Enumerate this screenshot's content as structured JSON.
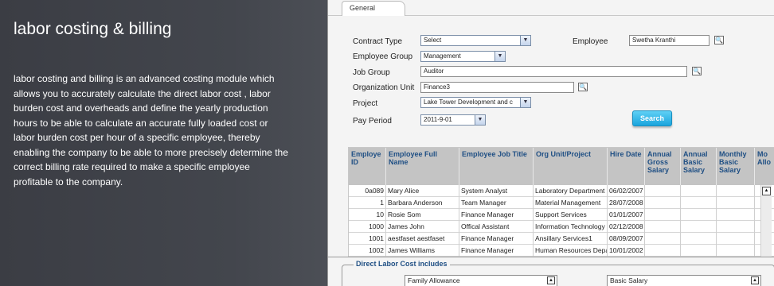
{
  "promo": {
    "title": "labor costing & billing",
    "description": "labor costing and billing is an advanced costing module which allows you to accurately calculate the direct labor cost , labor burden cost and overheads and define the yearly production hours to be able to calculate an accurate fully loaded cost or labor burden cost per hour of a specific employee, thereby enabling the company to be able to more precisely determine the correct billing rate required to make a specific employee profitable to the company."
  },
  "tabs": {
    "general": "General"
  },
  "form": {
    "contract_type": {
      "label": "Contract Type",
      "value": "Select"
    },
    "employee": {
      "label": "Employee",
      "value": "Swetha Kranthi"
    },
    "employee_group": {
      "label": "Employee Group",
      "value": "Management"
    },
    "job_group": {
      "label": "Job Group",
      "value": "Auditor"
    },
    "org_unit": {
      "label": "Organization Unit",
      "value": "Finance3"
    },
    "project": {
      "label": "Project",
      "value": "Lake Tower Development and  c"
    },
    "pay_period": {
      "label": "Pay Period",
      "value": "2011-9-01"
    },
    "search_button": "Search",
    "lookup_glyph": "🔍"
  },
  "grid": {
    "headers": [
      "Employe ID",
      "Employee Full Name",
      "Employee Job Title",
      "Org Unit/Project",
      "Hire Date",
      "Annual Gross Salary",
      "Annual Basic Salary",
      "Monthly Basic Salary",
      "Mo Allo"
    ],
    "rows": [
      [
        "0a089",
        "Mary Alice",
        "System Analyst",
        "Laboratory Department",
        "06/02/2007"
      ],
      [
        "1",
        "Barbara Anderson",
        "Team Manager",
        "Material Management",
        "28/07/2008"
      ],
      [
        "10",
        "Rosie Som",
        "Finance Manager",
        "Support Services",
        "01/01/2007"
      ],
      [
        "1000",
        "James John",
        "Offical Assistant",
        "Information Technology",
        "02/12/2008"
      ],
      [
        "1001",
        "aestfaset aestfaset",
        "Finance Manager",
        "Ansillary Services1",
        "08/09/2007"
      ],
      [
        "1002",
        "James Williams",
        "Finance Manager",
        "Human Resources Depa",
        "10/01/2002"
      ]
    ]
  },
  "direct_labor": {
    "legend": "Direct Labor Cost includes",
    "left_list_first": "Family Allowance",
    "right_list_first": "Basic Salary"
  },
  "colors": {
    "accent": "#1aa4dd",
    "header_text": "#1f4f84"
  }
}
